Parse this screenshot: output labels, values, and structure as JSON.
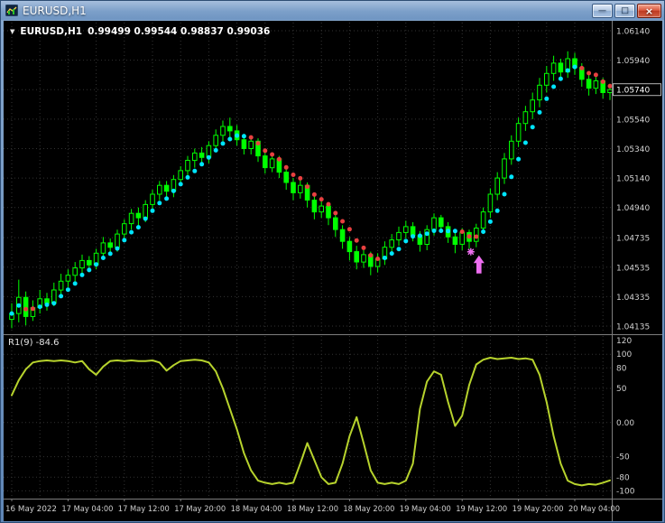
{
  "window": {
    "title": "EURUSD,H1",
    "controls": {
      "minimize": "—",
      "maximize": "□",
      "close": "×"
    }
  },
  "chart_header": {
    "dropdown_icon": "▼",
    "symbol": "EURUSD,H1",
    "ohlc": "0.99499 0.99544 0.98837 0.99036"
  },
  "price_scale": {
    "labels": [
      "1.06140",
      "1.05940",
      "1.05740",
      "1.05540",
      "1.05340",
      "1.05140",
      "1.04940",
      "1.04735",
      "1.04535",
      "1.04335",
      "1.04135"
    ],
    "current_price": "1.05740"
  },
  "time_scale": {
    "labels": [
      "16 May 2022",
      "17 May 04:00",
      "17 May 12:00",
      "17 May 20:00",
      "18 May 04:00",
      "18 May 12:00",
      "18 May 20:00",
      "19 May 04:00",
      "19 May 12:00",
      "19 May 20:00",
      "20 May 04:00"
    ],
    "ticks_every_candles": 8
  },
  "indicator_panel": {
    "label": "R1(9) -84.6",
    "scale_labels": [
      "120",
      "100",
      "80",
      "50",
      "0.00",
      "-50",
      "-80",
      "-100"
    ],
    "scale_values": [
      120,
      100,
      80,
      50,
      0,
      -50,
      -80,
      -100
    ],
    "level_lines": [
      100,
      80,
      50,
      0,
      -50,
      -80,
      -100
    ],
    "line_color": "#b7d32d"
  },
  "colors": {
    "background": "#000000",
    "grid": "#333333",
    "bull_candle": "#00ff00",
    "scale_text": "#d0d0d0",
    "separator": "#7d7d7d"
  },
  "chart_data": [
    {
      "type": "candlestick",
      "symbol": "EURUSD",
      "timeframe": "H1",
      "ylim": [
        1.04135,
        1.0614
      ],
      "ohlc": [
        [
          1.0418,
          1.0429,
          1.0412,
          1.0422
        ],
        [
          1.0422,
          1.0445,
          1.0416,
          1.0433
        ],
        [
          1.0433,
          1.0437,
          1.0414,
          1.042
        ],
        [
          1.042,
          1.0431,
          1.0417,
          1.0426
        ],
        [
          1.0426,
          1.0438,
          1.0422,
          1.0432
        ],
        [
          1.0432,
          1.0436,
          1.0424,
          1.0429
        ],
        [
          1.0429,
          1.0443,
          1.0427,
          1.0438
        ],
        [
          1.0438,
          1.0449,
          1.0434,
          1.0444
        ],
        [
          1.0444,
          1.0452,
          1.044,
          1.0448
        ],
        [
          1.0448,
          1.0457,
          1.0444,
          1.0453
        ],
        [
          1.0453,
          1.0462,
          1.0449,
          1.0458
        ],
        [
          1.0458,
          1.0461,
          1.045,
          1.0455
        ],
        [
          1.0455,
          1.0466,
          1.0452,
          1.0463
        ],
        [
          1.0463,
          1.0474,
          1.0459,
          1.047
        ],
        [
          1.047,
          1.0473,
          1.0462,
          1.0467
        ],
        [
          1.0467,
          1.0479,
          1.0464,
          1.0476
        ],
        [
          1.0476,
          1.0486,
          1.0472,
          1.0483
        ],
        [
          1.0483,
          1.0493,
          1.0479,
          1.049
        ],
        [
          1.049,
          1.0494,
          1.0482,
          1.0487
        ],
        [
          1.0487,
          1.0499,
          1.0484,
          1.0496
        ],
        [
          1.0496,
          1.0506,
          1.0492,
          1.0503
        ],
        [
          1.0503,
          1.0512,
          1.0499,
          1.0509
        ],
        [
          1.0509,
          1.0512,
          1.05,
          1.0505
        ],
        [
          1.0505,
          1.0516,
          1.0501,
          1.0513
        ],
        [
          1.0513,
          1.0522,
          1.0509,
          1.0519
        ],
        [
          1.0519,
          1.0529,
          1.0515,
          1.0526
        ],
        [
          1.0526,
          1.0534,
          1.0521,
          1.0531
        ],
        [
          1.0531,
          1.0535,
          1.0523,
          1.0528
        ],
        [
          1.0528,
          1.0539,
          1.0524,
          1.0536
        ],
        [
          1.0536,
          1.0547,
          1.0532,
          1.0543
        ],
        [
          1.0543,
          1.0553,
          1.0539,
          1.0549
        ],
        [
          1.0549,
          1.0555,
          1.0541,
          1.0546
        ],
        [
          1.0546,
          1.055,
          1.0536,
          1.054
        ],
        [
          1.054,
          1.0544,
          1.053,
          1.0534
        ],
        [
          1.0534,
          1.0542,
          1.053,
          1.0539
        ],
        [
          1.0539,
          1.0541,
          1.0525,
          1.0529
        ],
        [
          1.0529,
          1.0533,
          1.0517,
          1.0521
        ],
        [
          1.0521,
          1.0531,
          1.0518,
          1.0527
        ],
        [
          1.0527,
          1.0529,
          1.0514,
          1.0518
        ],
        [
          1.0518,
          1.0521,
          1.0506,
          1.0511
        ],
        [
          1.0511,
          1.0514,
          1.0499,
          1.0504
        ],
        [
          1.0504,
          1.0513,
          1.05,
          1.0509
        ],
        [
          1.0509,
          1.0511,
          1.0494,
          1.0499
        ],
        [
          1.0499,
          1.0502,
          1.0486,
          1.0491
        ],
        [
          1.0491,
          1.0499,
          1.0487,
          1.0495
        ],
        [
          1.0495,
          1.0497,
          1.0482,
          1.0487
        ],
        [
          1.0487,
          1.049,
          1.0474,
          1.0479
        ],
        [
          1.0479,
          1.0482,
          1.0466,
          1.0471
        ],
        [
          1.0471,
          1.0474,
          1.0458,
          1.0464
        ],
        [
          1.0464,
          1.0468,
          1.0452,
          1.0457
        ],
        [
          1.0457,
          1.0466,
          1.0453,
          1.0462
        ],
        [
          1.0462,
          1.0464,
          1.0448,
          1.0454
        ],
        [
          1.0454,
          1.0463,
          1.045,
          1.0459
        ],
        [
          1.0459,
          1.0471,
          1.0455,
          1.0467
        ],
        [
          1.0467,
          1.0476,
          1.0462,
          1.0472
        ],
        [
          1.0472,
          1.0481,
          1.0468,
          1.0477
        ],
        [
          1.0477,
          1.0485,
          1.0473,
          1.0481
        ],
        [
          1.0481,
          1.0484,
          1.0471,
          1.0475
        ],
        [
          1.0475,
          1.0478,
          1.0464,
          1.0469
        ],
        [
          1.0469,
          1.0482,
          1.0465,
          1.0479
        ],
        [
          1.0479,
          1.049,
          1.0475,
          1.0487
        ],
        [
          1.0487,
          1.0489,
          1.0477,
          1.0481
        ],
        [
          1.0481,
          1.0484,
          1.047,
          1.0474
        ],
        [
          1.0474,
          1.0477,
          1.0463,
          1.0469
        ],
        [
          1.0469,
          1.048,
          1.0465,
          1.0477
        ],
        [
          1.0477,
          1.0479,
          1.0466,
          1.0471
        ],
        [
          1.0471,
          1.0483,
          1.0467,
          1.048
        ],
        [
          1.048,
          1.0494,
          1.0476,
          1.0491
        ],
        [
          1.0491,
          1.0507,
          1.0487,
          1.0503
        ],
        [
          1.0503,
          1.0518,
          1.0499,
          1.0514
        ],
        [
          1.0514,
          1.0531,
          1.051,
          1.0527
        ],
        [
          1.0527,
          1.0543,
          1.0523,
          1.0539
        ],
        [
          1.0539,
          1.0555,
          1.0535,
          1.0551
        ],
        [
          1.0551,
          1.0563,
          1.0546,
          1.0559
        ],
        [
          1.0559,
          1.0572,
          1.0554,
          1.0567
        ],
        [
          1.0567,
          1.0582,
          1.0562,
          1.0577
        ],
        [
          1.0577,
          1.059,
          1.0572,
          1.0585
        ],
        [
          1.0585,
          1.0597,
          1.058,
          1.0592
        ],
        [
          1.0592,
          1.0595,
          1.0581,
          1.0586
        ],
        [
          1.0586,
          1.06,
          1.0582,
          1.0595
        ],
        [
          1.0595,
          1.0599,
          1.0584,
          1.0589
        ],
        [
          1.0589,
          1.0592,
          1.0576,
          1.0581
        ],
        [
          1.0581,
          1.0585,
          1.057,
          1.0575
        ],
        [
          1.0575,
          1.0584,
          1.0571,
          1.058
        ],
        [
          1.058,
          1.0582,
          1.0568,
          1.0572
        ],
        [
          1.0572,
          1.0578,
          1.0567,
          1.0574
        ]
      ],
      "dot_overlay": {
        "description": "trend dot ribbon = SMA(5) of close, cyan when rising, red when falling",
        "period": 5,
        "up_color": "#00e5ff",
        "down_color": "#e84040"
      },
      "marker": {
        "index": 66,
        "price": 1.0467,
        "shape": "star-and-up-arrow",
        "color": "#ee6ef0",
        "direction": "up"
      }
    },
    {
      "type": "line",
      "name": "R1(9)",
      "current_value": -84.6,
      "ylim": [
        -110,
        128
      ],
      "values": [
        40,
        62,
        78,
        88,
        90,
        91,
        90,
        91,
        90,
        88,
        90,
        78,
        70,
        82,
        90,
        91,
        90,
        91,
        90,
        90,
        91,
        88,
        76,
        84,
        90,
        91,
        92,
        91,
        88,
        75,
        50,
        20,
        -10,
        -45,
        -70,
        -85,
        -88,
        -90,
        -88,
        -90,
        -88,
        -60,
        -30,
        -55,
        -80,
        -90,
        -88,
        -60,
        -20,
        8,
        -30,
        -70,
        -88,
        -90,
        -88,
        -90,
        -85,
        -60,
        20,
        60,
        75,
        70,
        30,
        -5,
        10,
        55,
        85,
        92,
        95,
        93,
        94,
        95,
        93,
        94,
        92,
        70,
        30,
        -20,
        -60,
        -85,
        -90,
        -92,
        -90,
        -91,
        -88,
        -84.6
      ]
    }
  ]
}
